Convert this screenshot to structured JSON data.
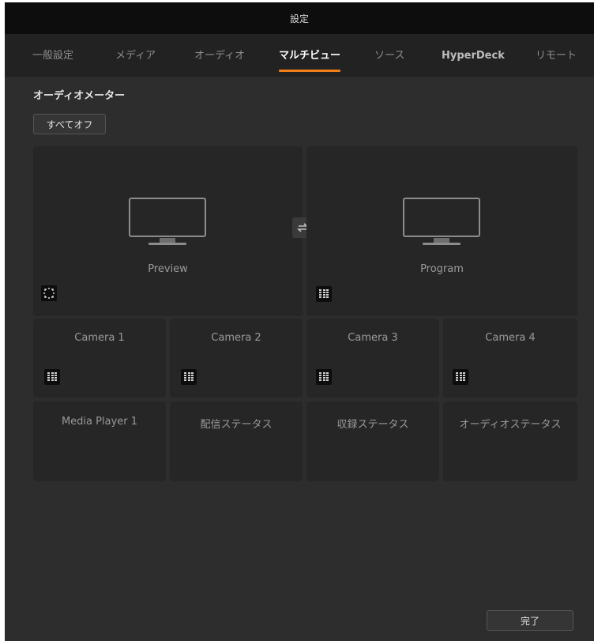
{
  "window": {
    "title": "設定"
  },
  "tabs": [
    {
      "label": "一般設定",
      "active": false
    },
    {
      "label": "メディア",
      "active": false
    },
    {
      "label": "オーディオ",
      "active": false
    },
    {
      "label": "マルチビュー",
      "active": true
    },
    {
      "label": "ソース",
      "active": false
    },
    {
      "label": "HyperDeck",
      "active": false
    },
    {
      "label": "リモート",
      "active": false
    }
  ],
  "audio_meters": {
    "section_title": "オーディオメーター",
    "all_off_label": "すべてオフ"
  },
  "multiview": {
    "preview": {
      "label": "Preview",
      "icon": "safe-area-icon"
    },
    "program": {
      "label": "Program",
      "icon": "audio-meter-icon"
    },
    "swap_icon": "swap-icon",
    "cameras": [
      {
        "label": "Camera 1"
      },
      {
        "label": "Camera 2"
      },
      {
        "label": "Camera 3"
      },
      {
        "label": "Camera 4"
      }
    ],
    "status_row": [
      {
        "label": "Media Player 1"
      },
      {
        "label": "配信ステータス"
      },
      {
        "label": "収録ステータス"
      },
      {
        "label": "オーディオステータス"
      }
    ]
  },
  "footer": {
    "done_label": "完了"
  },
  "colors": {
    "accent": "#f07f19",
    "background": "#2d2d2d",
    "cell": "#262626",
    "titlebar": "#0d0d0d"
  }
}
